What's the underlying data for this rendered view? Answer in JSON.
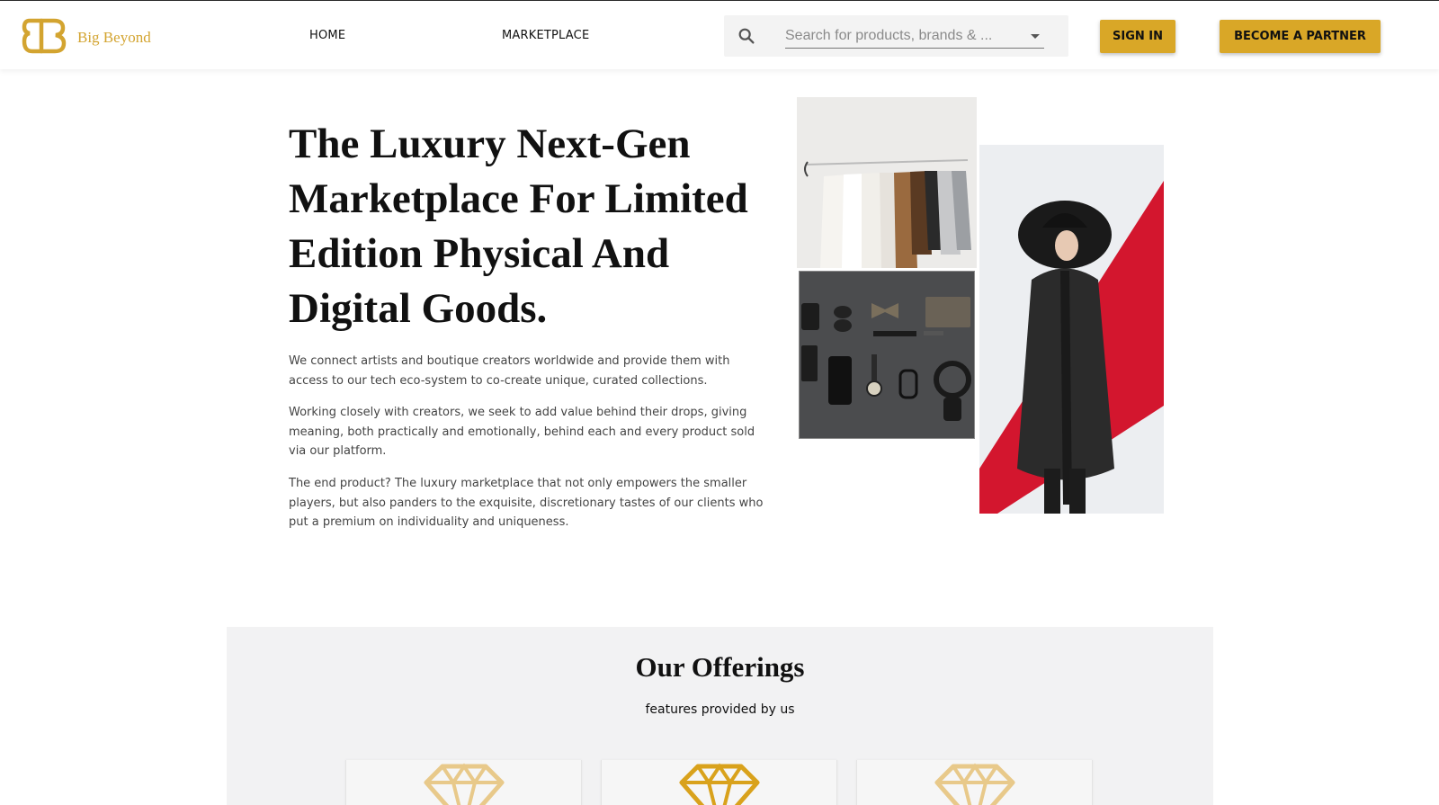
{
  "brand": {
    "name": "Big Beyond",
    "logo_icon": "bb-monogram-icon",
    "color": "#d3a430"
  },
  "nav": {
    "home": "HOME",
    "marketplace": "MARKETPLACE"
  },
  "search": {
    "placeholder": "Search for products, brands & ...",
    "icon": "search-icon"
  },
  "buttons": {
    "sign_in": "SIGN IN",
    "partner": "BECOME A PARTNER",
    "color": "#d9a727"
  },
  "hero": {
    "title": "The Luxury Next-Gen Marketplace For Limited Edition Physical And Digital Goods.",
    "paragraphs": [
      "We connect artists and boutique creators worldwide and provide them with access to our tech eco-system to co-create unique, curated collections.",
      "Working closely with creators, we seek to add value behind their drops, giving meaning, both practically and emotionally, behind each and every product sold via our platform.",
      "The end product? The luxury marketplace that not only empowers the smaller players, but also panders to the exquisite, discretionary tastes of our clients who put a premium on individuality and uniqueness."
    ]
  },
  "offerings": {
    "title": "Our Offerings",
    "subtitle": "features provided by us",
    "cards": [
      {
        "icon": "diamond-icon",
        "color": "#e8c98a"
      },
      {
        "icon": "diamond-icon",
        "color": "#d9a21c"
      },
      {
        "icon": "diamond-icon",
        "color": "#e8c98a"
      }
    ]
  }
}
